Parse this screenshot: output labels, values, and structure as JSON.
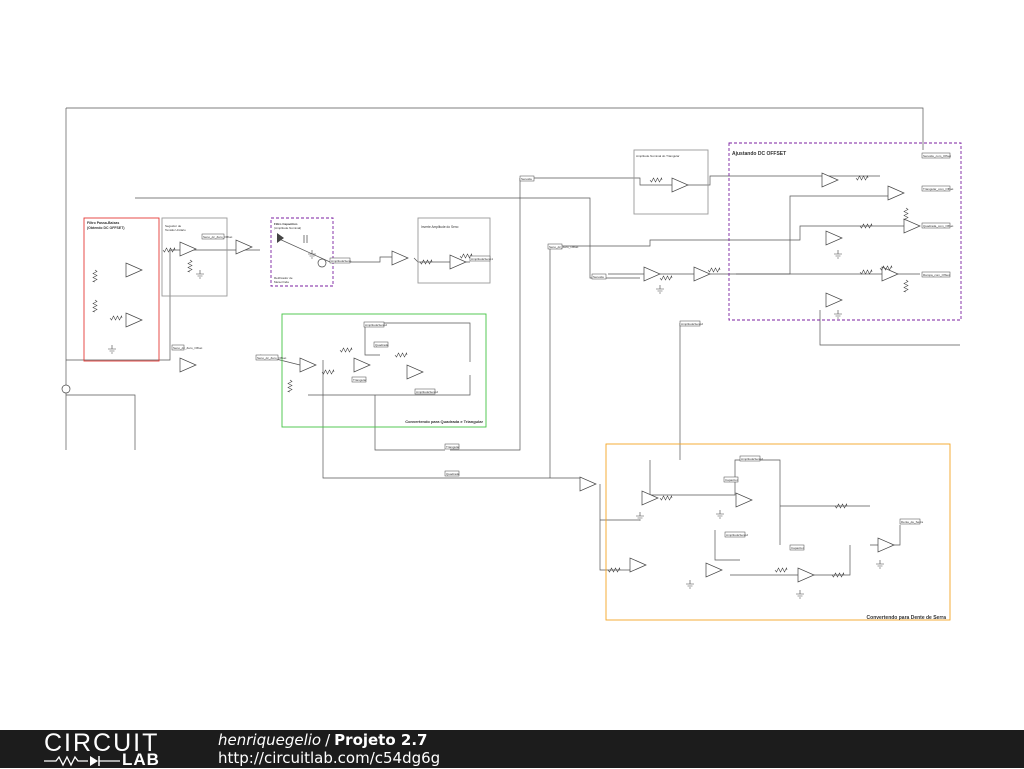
{
  "diagram": {
    "block_titles": {
      "low_pass": [
        "Filtro Passa-Baixas",
        "(Obtendo DC OFFSET)"
      ],
      "unity_follower": [
        "Seguidor de",
        "Tensão Unitário"
      ],
      "capacitive_filter": [
        "Filtro Capacitivo",
        "(Amplitude Nominal)"
      ],
      "half_wave": [
        "Retificador de",
        "Meia-Onda"
      ],
      "invert_sine": "Inverte Amplitude do Seno",
      "nominal_triangle": "Amplitude Nominal do Triangular",
      "dc_offset": "Ajustando DC OFFSET",
      "square_triangle": "Convertendo para Quadrada e Triangular",
      "sawtooth": "Convertendo para Dente de Serra"
    },
    "net_labels": {
      "senoide": "Senoide",
      "seno_dc": "Seno_dc_Zero_Offset",
      "amplitude": "AmplitudeSeno",
      "inv": "AmplitudeSeno1",
      "amp2": "AmplitudeSeno2",
      "triangular": "Triangular",
      "quadrada": "Quadrada",
      "seno_ofs": "Senoide_com_Offset",
      "quad_ofs": "Quadrada_com_Offset",
      "tri_ofs": "Triangular_com_Offset",
      "rampa_ofs": "Rampa_com_Offset",
      "serra": "Dente_de_Serra",
      "capacitor": "Capacitor"
    }
  },
  "colors": {
    "wire": "#555555",
    "low_pass": "#e53935",
    "capacitive": "#7b1fa2",
    "square_triangle": "#43c543",
    "dc_offset": "#7b1fa2",
    "sawtooth": "#f5a623",
    "gray_box": "#999999"
  },
  "footer": {
    "logo_top": "CIRCUIT",
    "logo_bottom": "LAB",
    "author": "henriquegelio",
    "separator": "/",
    "project": "Projeto 2.7",
    "url": "http://circuitlab.com/c54dg6g"
  }
}
